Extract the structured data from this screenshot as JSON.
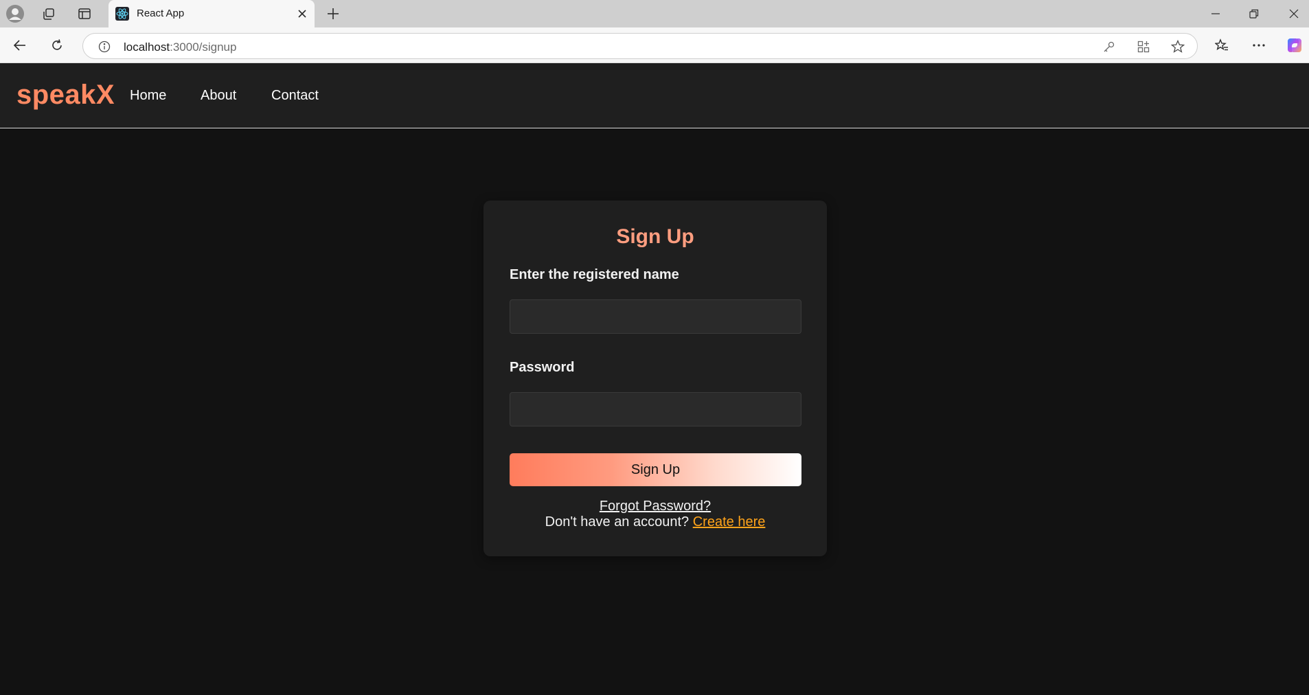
{
  "browser": {
    "tab_title": "React App",
    "url_host": "localhost",
    "url_path": ":3000/signup",
    "favicon": "react-logo-icon"
  },
  "navbar": {
    "logo": "speakX",
    "links": [
      "Home",
      "About",
      "Contact"
    ]
  },
  "form": {
    "title": "Sign Up",
    "name_label": "Enter the registered name",
    "name_value": "",
    "password_label": "Password",
    "password_value": "",
    "submit_label": "Sign Up",
    "forgot_label": "Forgot Password?",
    "no_account_text": "Don't have an account?",
    "create_link": "Create here"
  },
  "colors": {
    "accent": "#ff8a63",
    "title": "#ff9e80",
    "link": "#ffa31a",
    "background": "#121212",
    "card": "#1f1f1f"
  }
}
